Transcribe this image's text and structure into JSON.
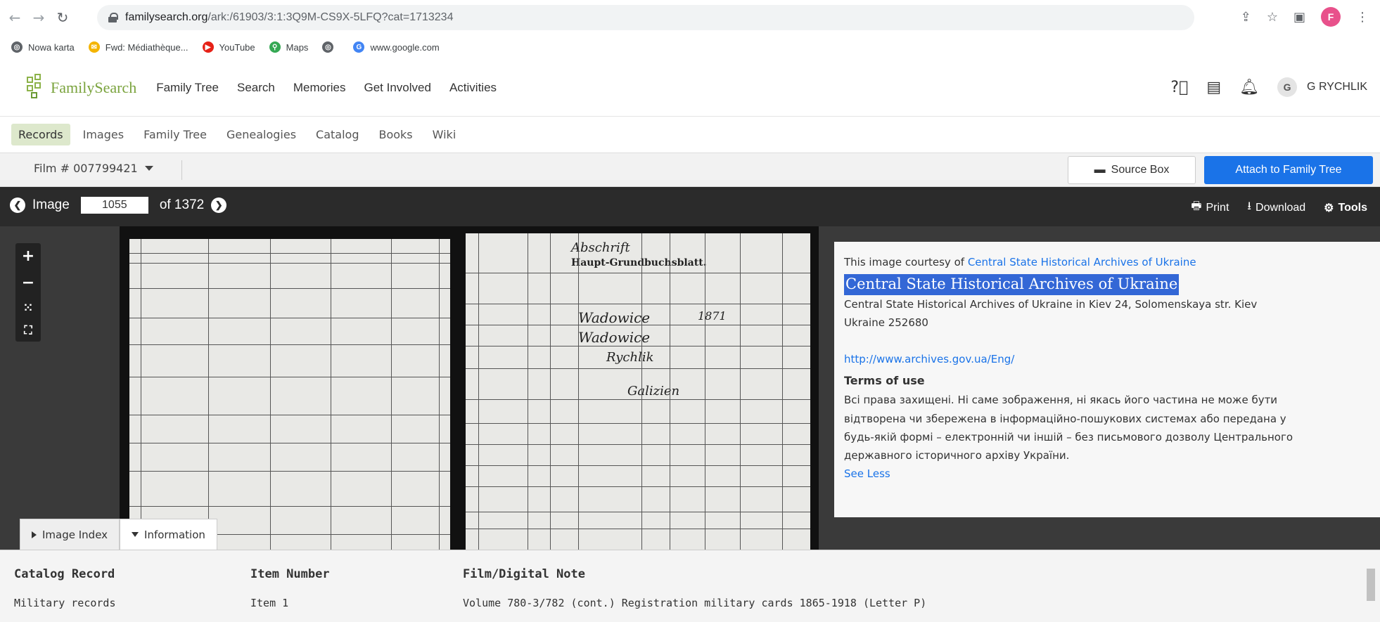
{
  "browser": {
    "url_host": "familysearch.org",
    "url_path": "/ark:/61903/3:1:3Q9M-CS9X-5LFQ?cat=1713234",
    "profile_initial": "F",
    "bookmarks": [
      {
        "label": "Nowa karta",
        "color": "#5f6368",
        "glyph": "◎"
      },
      {
        "label": "Fwd: Médiathèque...",
        "color": "#f4b400",
        "glyph": "✉"
      },
      {
        "label": "YouTube",
        "color": "#e62117",
        "glyph": "▶"
      },
      {
        "label": "Maps",
        "color": "#34a853",
        "glyph": "⚲"
      },
      {
        "label": "",
        "color": "#5f6368",
        "glyph": "◎"
      },
      {
        "label": "www.google.com",
        "color": "#4285f4",
        "glyph": "G"
      }
    ]
  },
  "header": {
    "logo_text": "FamilySearch",
    "nav": [
      "Family Tree",
      "Search",
      "Memories",
      "Get Involved",
      "Activities"
    ],
    "user_initial": "G",
    "user_name": "G RYCHLIK"
  },
  "subnav": {
    "tabs": [
      "Records",
      "Images",
      "Family Tree",
      "Genealogies",
      "Catalog",
      "Books",
      "Wiki"
    ],
    "active": "Records"
  },
  "film": {
    "label": "Film # 007799421",
    "source_box": "Source Box",
    "attach": "Attach to Family Tree"
  },
  "image_toolbar": {
    "image_label": "Image",
    "current": "1055",
    "of_label": "of 1372",
    "print": "Print",
    "download": "Download",
    "tools": "Tools"
  },
  "scan": {
    "header_text": "Haupt-Grundbuchsblatt.",
    "hw_1": "Abschrift",
    "hw_2": "Wadowice",
    "hw_3": "Wadowice",
    "hw_4": "Galizien",
    "hw_5": "Rychlik",
    "hw_6": "1871"
  },
  "info": {
    "courtesy_prefix": "This image courtesy of",
    "courtesy_link": "Central State Historical Archives of Ukraine",
    "archive_title": "Central State Historical Archives of Ukraine",
    "address_1": "Central State Historical Archives of Ukraine in Kiev 24, Solomenskaya str. Kiev",
    "address_2": "Ukraine 252680",
    "website": "http://www.archives.gov.ua/Eng/",
    "terms_title": "Terms of use",
    "terms_1": "Всі права захищені. Ні саме зображення, ні якась його частина не може бути",
    "terms_2": "відтворена чи збережена в інформаційно-пошукових системах або передана у",
    "terms_3": "будь-якій формі – електронній чи іншій – без письмового дозволу Центрального",
    "terms_4": "державного історичного архіву України.",
    "see_less": "See Less"
  },
  "bottom_tabs": {
    "image_index": "Image Index",
    "information": "Information"
  },
  "record": {
    "catalog_h": "Catalog Record",
    "catalog_v": "Military records",
    "item_h": "Item Number",
    "item_v": "Item 1",
    "note_h": "Film/Digital Note",
    "note_v": "Volume 780-3/782 (cont.) Registration military cards 1865-1918 (Letter P)"
  }
}
